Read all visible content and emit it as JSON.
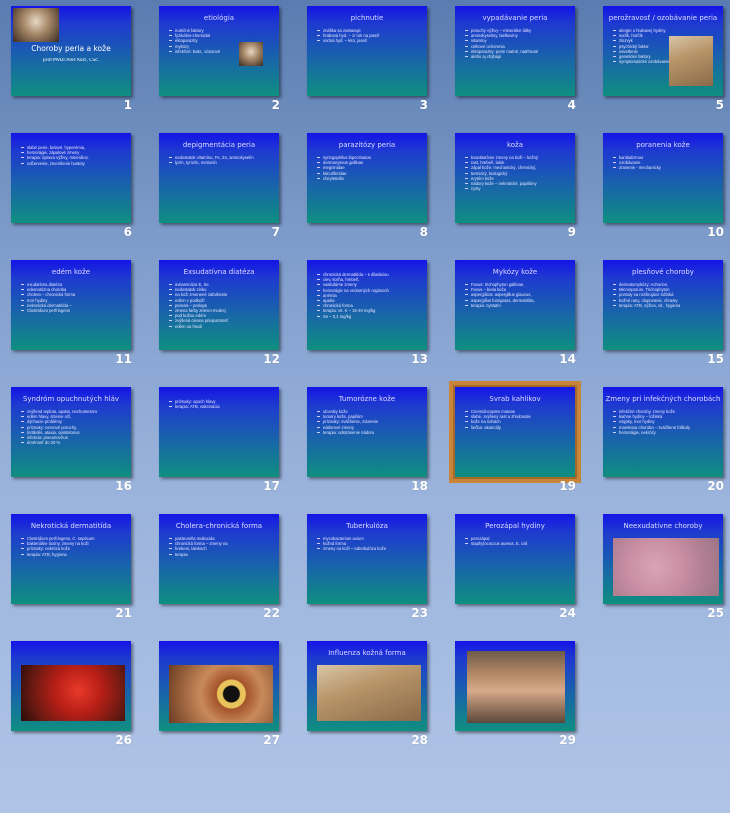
{
  "slides": [
    {
      "num": "1",
      "title": "Choroby peria a kože",
      "subtitle": "prof.MVDr.Aleš Kočí, CSc.",
      "bullets": []
    },
    {
      "num": "2",
      "title": "etiológia",
      "bullets": [
        "nutričné faktory",
        "fyzikálno-chemické",
        "ektoparazity",
        "mykózy",
        "infekčné: bakt., vírusové"
      ]
    },
    {
      "num": "3",
      "title": "pichnutie",
      "bullets": [
        "znáška sa zastavuje",
        "hrabavá hyd. – 1/ rok na jaseň",
        "vodná hyd. – leto, jaseň"
      ]
    },
    {
      "num": "4",
      "title": "vypadávanie peria",
      "bullets": [
        "poruchy výživy – minerálne látky",
        "aminokyseliny, bielkoviny",
        "vitamíny",
        "celkové ochorenia",
        "ektoparazity: perie matné, natrhnuté",
        "alebo aj chýbajú"
      ]
    },
    {
      "num": "5",
      "title": "perožravosť / ozobávanie peria",
      "bullets": [
        "alergie u hrabavej hydiny",
        "sodík, horčík",
        "zlozvyk",
        "psychický faktor",
        "osvetlenie",
        "genetické faktory",
        "symptomatické ozobávanie"
      ]
    },
    {
      "num": "6",
      "title": "",
      "bullets": [
        "slabé perie, belavé, hyperémia,",
        "hemorágie, zápalové zmeny",
        "terapia: úprava výživy, minerálov,",
        "odčervenie, zmenšenie hustoty"
      ]
    },
    {
      "num": "7",
      "title": "depigmentácia peria",
      "bullets": [
        "nedostatok vitamínu, Fe, Zn, aminokyselín",
        "lyzín, tyrozín, metionín"
      ]
    },
    {
      "num": "8",
      "title": "parazitózy peria",
      "bullets": [
        "syringophilus bipectinatus",
        "dermanyssus gallinae",
        "megninidae",
        "falculiferidae",
        "cheyletiella"
      ]
    },
    {
      "num": "9",
      "title": "koža",
      "bullets": [
        "kvantitatívne zmeny na koži – kožný",
        "rast, hrebeň, lalok",
        "zápal kože: mechanický, chemický,",
        "termický, biologický",
        "erytém kože",
        "nádory kože – nekrotické, papilómy",
        "cysty"
      ]
    },
    {
      "num": "10",
      "title": "poranenia kože",
      "bullets": [
        "kanibalizmus",
        "ozobávanie",
        "zranenie - mechanicky"
      ]
    },
    {
      "num": "11",
      "title": "edém kože",
      "bullets": [
        "exudatívna diatéza",
        "edematózna choroba",
        "cholera – chronická forma",
        "mor hydiny",
        "nekrotická dermatitída –",
        "Clostridium perfringens"
      ]
    },
    {
      "num": "12",
      "title": "Exsudatívna diatéza",
      "bullets": [
        "avitaminóza E, Se",
        "nedostatok zinku",
        "na koži zmenené zafarbenie",
        "edém v podkoží",
        "perosis – prolaps",
        "zmena farby zeleno-modrej",
        "pod kožou edém",
        "zvýšená cievna priepustnosť",
        "edém na hrudi"
      ]
    },
    {
      "num": "13",
      "title": "",
      "bullets": [
        "chronická dermatitída – s dilatáciou",
        "ciev, korňa, hrebeň,",
        "vaskulárne zmeny",
        "hemorágie na vnútorných orgánoch",
        "anémia",
        "apatia",
        "chronická forma",
        "terapia: vit. K – 15-40 mg/kg",
        "Se – 0,1 mg/kg"
      ]
    },
    {
      "num": "14",
      "title": "Mykózy kože",
      "bullets": [
        "Favus: trichophyton gallinae,",
        "Favus – biela koža",
        "aspergilóza: aspergillus glaucus,",
        "aspergillus fumigatus, dermatitída,",
        "terapia: nystatín"
      ]
    },
    {
      "num": "15",
      "title": "plesňové choroby",
      "bullets": [
        "dermatomykózy: Achorion,",
        "Microsporum, Trichophyton",
        "pomaly sa rozširujúce ložiská",
        "kožné rany, olupovanie, chrasty",
        "terapia: ATB, výživa, vit., hygiena"
      ]
    },
    {
      "num": "16",
      "title": "Syndróm opuchnutých hláv",
      "bullets": [
        "zvýšená teplota, apatia, nechutenstvo",
        "edém hlavy, slzenie očí,",
        "dýchacie problémy",
        "príznaky: nervové poruchy,",
        "tortikolis, ataxia, opistotonus",
        "infekcia: pneumovírus",
        "úmrtnosť do 20 %"
      ]
    },
    {
      "num": "17",
      "title": "",
      "bullets": [
        "príznaky: opuch hlavy",
        "terapia: ATB, vakcinácia"
      ]
    },
    {
      "num": "18",
      "title": "Tumorózne kože",
      "bullets": [
        "ulceráty kože",
        "tumory kože, papilóm",
        "príznaky: zväčšenie, zdurenie",
        "nádorové zmeny",
        "terapia: odstránenie nádoru"
      ]
    },
    {
      "num": "19",
      "title": "Svrab kahlikov",
      "bullets": [
        "Cnemidocoptes mutans",
        "slabé, zvýšený rast a zhrubnutie",
        "kože na nohách",
        "liečba: akaricídy"
      ]
    },
    {
      "num": "20",
      "title": "Zmeny pri infekčných chorobách",
      "bullets": [
        "infekčné choroby, zmeny kože",
        "kiahne hydiny – ložiská",
        "osýpky, mor hydiny",
        "marekova choroba – zväčšené folikuly",
        "hemorágie, nekrózy"
      ]
    },
    {
      "num": "21",
      "title": "Nekrotická dermatitída",
      "bullets": [
        "Clostridium perfringens, C. septicum",
        "bakteriálne toxíny, zmeny na koži",
        "príznaky: nekróza kože",
        "terapia: ATB, hygiena"
      ]
    },
    {
      "num": "22",
      "title": "Cholera-chronická forma",
      "bullets": [
        "pasteurella multocida",
        "chronická forma – zmeny na",
        "hrebeni, lalokoch",
        "terapia"
      ]
    },
    {
      "num": "23",
      "title": "Tuberkulóza",
      "bullets": [
        "mycobacterium avium",
        "kožná forma",
        "zmeny na koži – tuberkulóza kože"
      ]
    },
    {
      "num": "24",
      "title": "Perozápal hydiny",
      "bullets": [
        "perozápal",
        "staphylococcus aureus, E. coli"
      ]
    },
    {
      "num": "25",
      "title": "Neexudatívne choroby",
      "bullets": []
    },
    {
      "num": "26",
      "title": "",
      "bullets": []
    },
    {
      "num": "27",
      "title": "",
      "bullets": []
    },
    {
      "num": "28",
      "title": "Influenza kožná forma",
      "bullets": []
    },
    {
      "num": "29",
      "title": "",
      "bullets": []
    }
  ],
  "selected_slide": "19",
  "colors": {
    "slide_top": "#1414e6",
    "slide_bottom": "#0f8f80",
    "selection": "#c8853a"
  }
}
